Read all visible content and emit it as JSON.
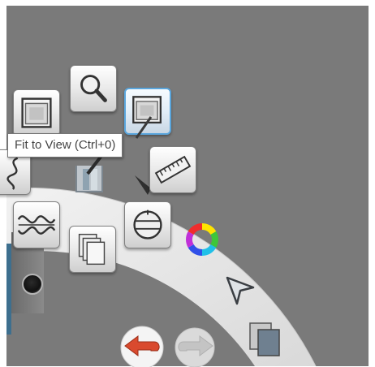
{
  "tooltip": {
    "text": "Fit to View (Ctrl+0)"
  },
  "colors": {
    "workspace": "#7a7a7a",
    "lagoon_ring": "#e8e8e8",
    "selected_border": "#5aa6dd",
    "undo_red": "#d94a2e"
  },
  "lagoon_tools": [
    {
      "id": "fit-to-view",
      "icon": "window-frame-icon",
      "selected": false
    },
    {
      "id": "zoom",
      "icon": "magnifier-icon",
      "selected": false
    },
    {
      "id": "fit-to-view-active",
      "icon": "window-frame-icon",
      "selected": true
    },
    {
      "id": "curves",
      "icon": "french-curve-icon",
      "selected": false
    },
    {
      "id": "brushes",
      "icon": "brush-holder-icon",
      "selected": false
    },
    {
      "id": "ruler",
      "icon": "ruler-icon",
      "selected": false
    },
    {
      "id": "symmetry",
      "icon": "waveform-icon",
      "selected": false
    },
    {
      "id": "layers",
      "icon": "stacked-pages-icon",
      "selected": false
    },
    {
      "id": "rotate-canvas",
      "icon": "compass-dial-icon",
      "selected": false
    },
    {
      "id": "color-wheel",
      "icon": "color-wheel-icon",
      "selected": false
    },
    {
      "id": "select",
      "icon": "arrow-cursor-icon",
      "selected": false
    },
    {
      "id": "copy",
      "icon": "copy-pages-icon",
      "selected": false
    },
    {
      "id": "undo",
      "icon": "undo-arrow-icon",
      "selected": false
    },
    {
      "id": "redo",
      "icon": "redo-arrow-icon",
      "selected": false
    }
  ]
}
